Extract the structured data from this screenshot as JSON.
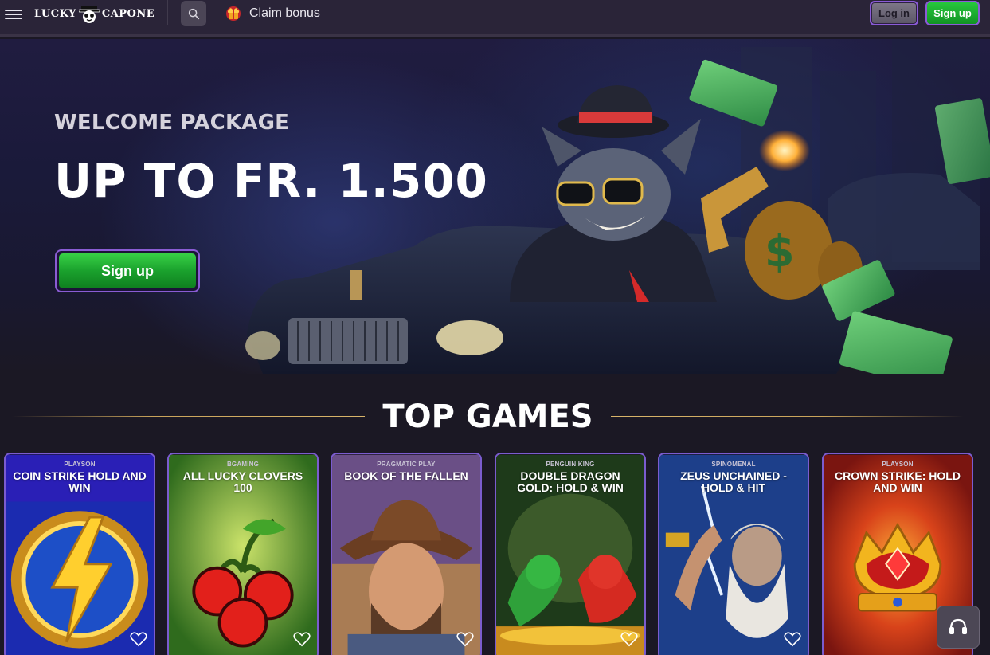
{
  "header": {
    "logo_left": "LUCKY",
    "logo_right": "CAPONE",
    "claim_label": "Claim bonus",
    "login_label": "Log in",
    "signup_label": "Sign up"
  },
  "hero": {
    "subtitle": "WELCOME PACKAGE",
    "title": "UP TO FR. 1.500",
    "cta_label": "Sign up"
  },
  "top_games": {
    "heading": "TOP GAMES",
    "games": [
      {
        "provider": "PLAYSON",
        "title": "COIN STRIKE HOLD AND WIN"
      },
      {
        "provider": "BGAMING",
        "title": "ALL LUCKY CLOVERS 100"
      },
      {
        "provider": "PRAGMATIC PLAY",
        "title": "BOOK OF THE FALLEN"
      },
      {
        "provider": "PENGUIN KING",
        "title": "DOUBLE DRAGON GOLD: HOLD & WIN"
      },
      {
        "provider": "SPINOMENAL",
        "title": "ZEUS UNCHAINED - HOLD & HIT"
      },
      {
        "provider": "PLAYSON",
        "title": "CROWN STRIKE: HOLD AND WIN"
      }
    ]
  },
  "icons": {
    "menu": "menu-icon",
    "search": "search-icon",
    "claim": "gift-icon",
    "favorite": "heart-icon",
    "support": "headset-icon"
  },
  "colors": {
    "accent_green": "#1aa12d",
    "accent_purple": "#8a5cd4",
    "gold_line": "#c9a35a",
    "background": "#1b1824"
  }
}
